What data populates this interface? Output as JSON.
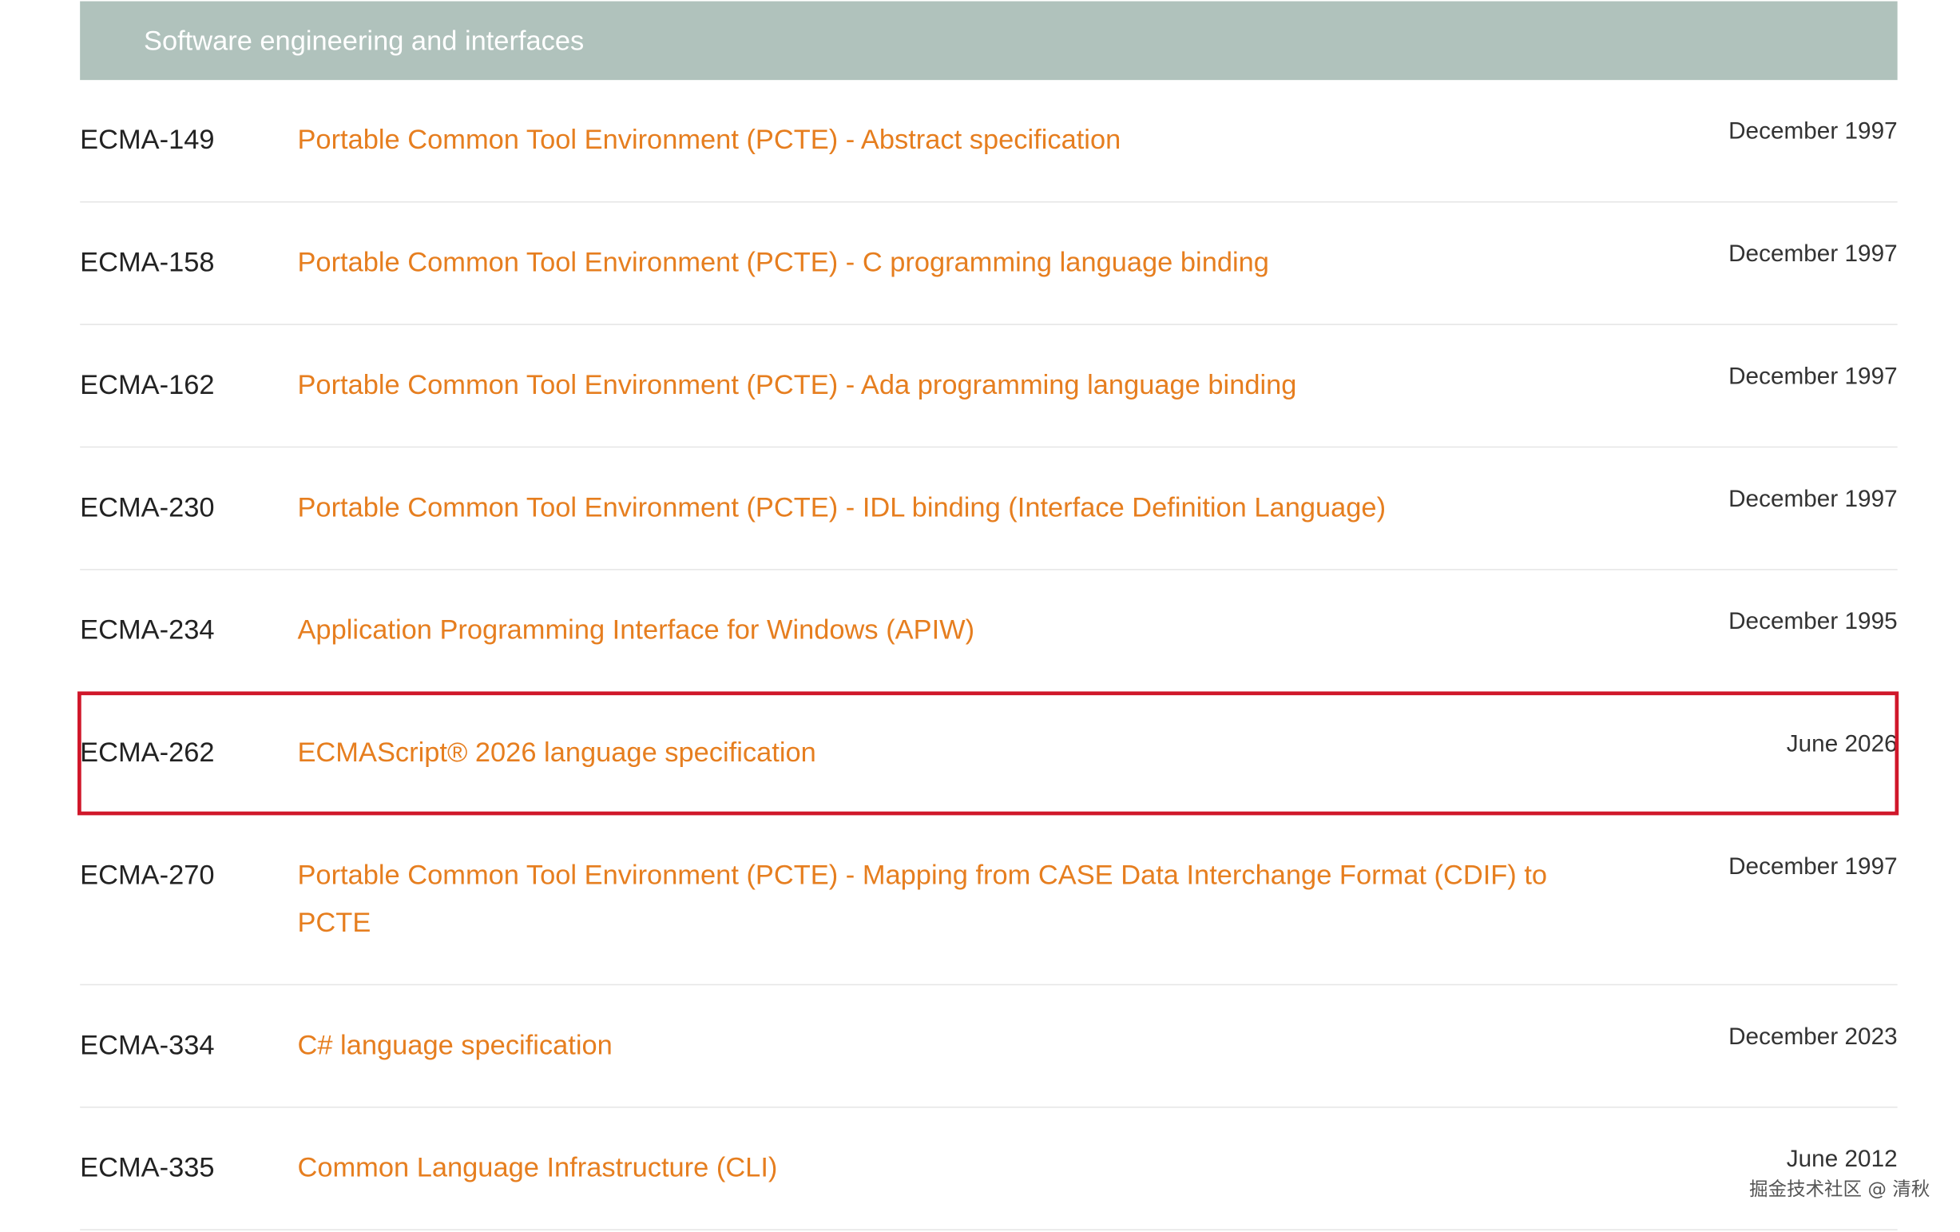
{
  "section": {
    "title": "Software engineering and interfaces"
  },
  "standards": [
    {
      "number": "ECMA-149",
      "title": "Portable Common Tool Environment (PCTE) - Abstract specification",
      "date": "December 1997"
    },
    {
      "number": "ECMA-158",
      "title": "Portable Common Tool Environment (PCTE) - C programming language binding",
      "date": "December 1997"
    },
    {
      "number": "ECMA-162",
      "title": "Portable Common Tool Environment (PCTE) - Ada programming language binding",
      "date": "December 1997"
    },
    {
      "number": "ECMA-230",
      "title": "Portable Common Tool Environment (PCTE) - IDL binding (Interface Definition Language)",
      "date": "December 1997"
    },
    {
      "number": "ECMA-234",
      "title": "Application Programming Interface for Windows (APIW)",
      "date": "December 1995"
    },
    {
      "number": "ECMA-262",
      "title": "ECMAScript® 2026 language specification",
      "date": "June 2026",
      "highlighted": true
    },
    {
      "number": "ECMA-270",
      "title": "Portable Common Tool Environment (PCTE) - Mapping from CASE Data Interchange Format (CDIF) to PCTE",
      "date": "December 1997"
    },
    {
      "number": "ECMA-334",
      "title": "C# language specification",
      "date": "December 2023"
    },
    {
      "number": "ECMA-335",
      "title": "Common Language Infrastructure (CLI)",
      "date": "June 2012"
    }
  ],
  "watermark": {
    "text": "掘金技术社区 @ 清秋"
  },
  "colors": {
    "header_background": "#b0c2bc",
    "link": "#e67e1f",
    "highlight_border": "#d0172a"
  }
}
